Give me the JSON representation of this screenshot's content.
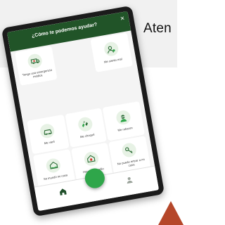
{
  "background": {
    "header_text": "Aten"
  },
  "modal": {
    "title": "¿Cómo te podemos ayudar?",
    "close_label": "×",
    "options": [
      {
        "label": "Tengo una emergencia médica",
        "icon": "ambulance-icon"
      },
      {
        "label": "",
        "icon": "empty"
      },
      {
        "label": "Me siento mal",
        "icon": "person-sick-icon"
      },
      {
        "label": "",
        "icon": "empty"
      },
      {
        "label": "",
        "icon": "empty"
      },
      {
        "label": "",
        "icon": "empty"
      },
      {
        "label": "Me varé",
        "icon": "car-breakdown-icon"
      },
      {
        "label": "Me choqué",
        "icon": "car-crash-icon"
      },
      {
        "label": "Me robaron",
        "icon": "thief-icon"
      },
      {
        "label": "Se inundó mi casa",
        "icon": "flooded-house-icon"
      },
      {
        "label": "Hay un incendio",
        "icon": "house-fire-icon"
      },
      {
        "label": "No puedo entrar a mi casa",
        "icon": "key-icon"
      }
    ]
  },
  "nav": {
    "home_icon": "home-icon",
    "action_icon": "action-fab",
    "other_icon": "profile-icon"
  },
  "colors": {
    "header_green": "#215428",
    "accent_green": "#2fa64a",
    "icon_bg": "#e7f2e5",
    "corner_shape": "#b5472a"
  }
}
